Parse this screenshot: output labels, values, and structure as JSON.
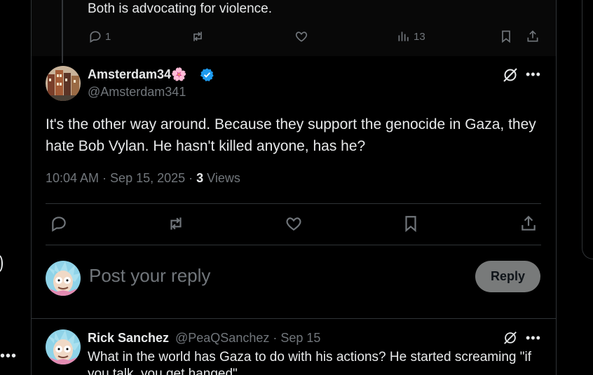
{
  "previous_tweet": {
    "text": "Both is advocating for violence.",
    "reply_count": "1",
    "view_count": "13"
  },
  "main_tweet": {
    "display_name": "Amsterdam34🌸",
    "handle": "@Amsterdam341",
    "text": "It's the other way around. Because they support the genocide in Gaza, they hate Bob Vylan. He hasn't killed anyone, has he?",
    "time": "10:04 AM · Sep 15, 2025 · ",
    "views_count": "3",
    "views_label": " Views",
    "verified_color": "#1d9bf0"
  },
  "compose": {
    "placeholder": "Post your reply",
    "button_label": "Reply"
  },
  "reply": {
    "display_name": "Rick Sanchez",
    "handle_date": "@PeaQSanchez · Sep 15",
    "text": "What in the world has Gaza to do with his actions? He started screaming \"if you talk, you get hanged\""
  },
  "icons": [
    "reply-icon",
    "repost-icon",
    "like-icon",
    "views-icon",
    "bookmark-icon",
    "share-icon",
    "grok-icon",
    "more-icon",
    "verified-icon"
  ]
}
